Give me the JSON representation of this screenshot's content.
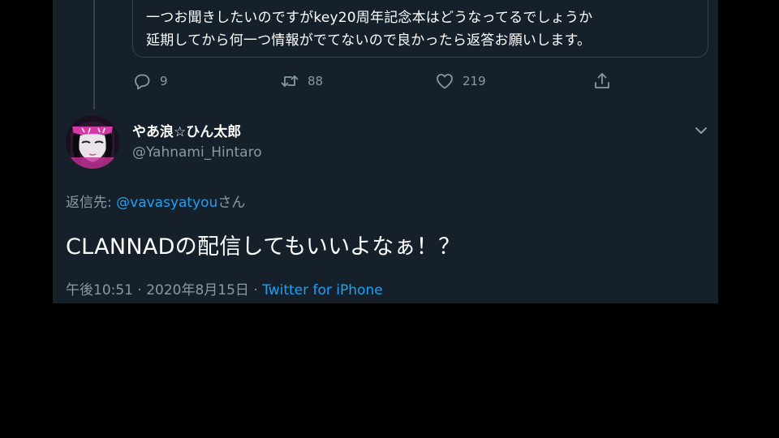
{
  "colors": {
    "background": "#15202b",
    "page_background": "#000000",
    "text_primary": "#ffffff",
    "text_secondary": "#8899a6",
    "accent": "#1da1f2",
    "border": "#38444d"
  },
  "quoted_tweet": {
    "line1": "一つお聞きしたいのですがkey20周年記念本はどうなってるでしょうか",
    "line2": "延期してから何一つ情報がでてないので良かったら返答お願いします。"
  },
  "actions": {
    "reply": {
      "icon": "reply-icon",
      "count": "9"
    },
    "retweet": {
      "icon": "retweet-icon",
      "count": "88"
    },
    "like": {
      "icon": "heart-icon",
      "count": "219"
    },
    "share": {
      "icon": "share-icon"
    }
  },
  "tweet": {
    "display_name": "やあ浪☆ひん太郎",
    "handle": "@Yahnami_Hintaro",
    "reply_prefix": "返信先: ",
    "reply_mention": "@vavasyatyou",
    "reply_suffix": "さん",
    "text": "CLANNADの配信してもいいよなぁ！？",
    "time": "午後10:51 · 2020年8月15日 · ",
    "source": "Twitter for iPhone",
    "menu_icon": "chevron-down-icon",
    "avatar_icon": "avatar"
  }
}
